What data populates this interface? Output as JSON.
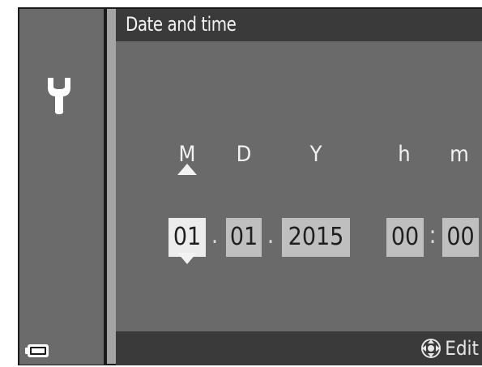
{
  "header": {
    "title": "Date and time"
  },
  "sidebar": {
    "icon": "wrench-icon",
    "battery_icon": "battery-icon"
  },
  "columns": {
    "month": "M",
    "day": "D",
    "year": "Y",
    "hour": "h",
    "minute": "m"
  },
  "fields": {
    "month": "01",
    "day": "01",
    "year": "2015",
    "hour": "00",
    "minute": "00",
    "selected": "month"
  },
  "separators": {
    "date": ".",
    "time": ":"
  },
  "footer": {
    "edit_label": "Edit",
    "edit_icon": "multi-selector-icon"
  },
  "colors": {
    "background": "#6a6a6a",
    "bars": "#3a3a3a",
    "selected_field": "#ececec",
    "field": "#bfbfbf"
  }
}
